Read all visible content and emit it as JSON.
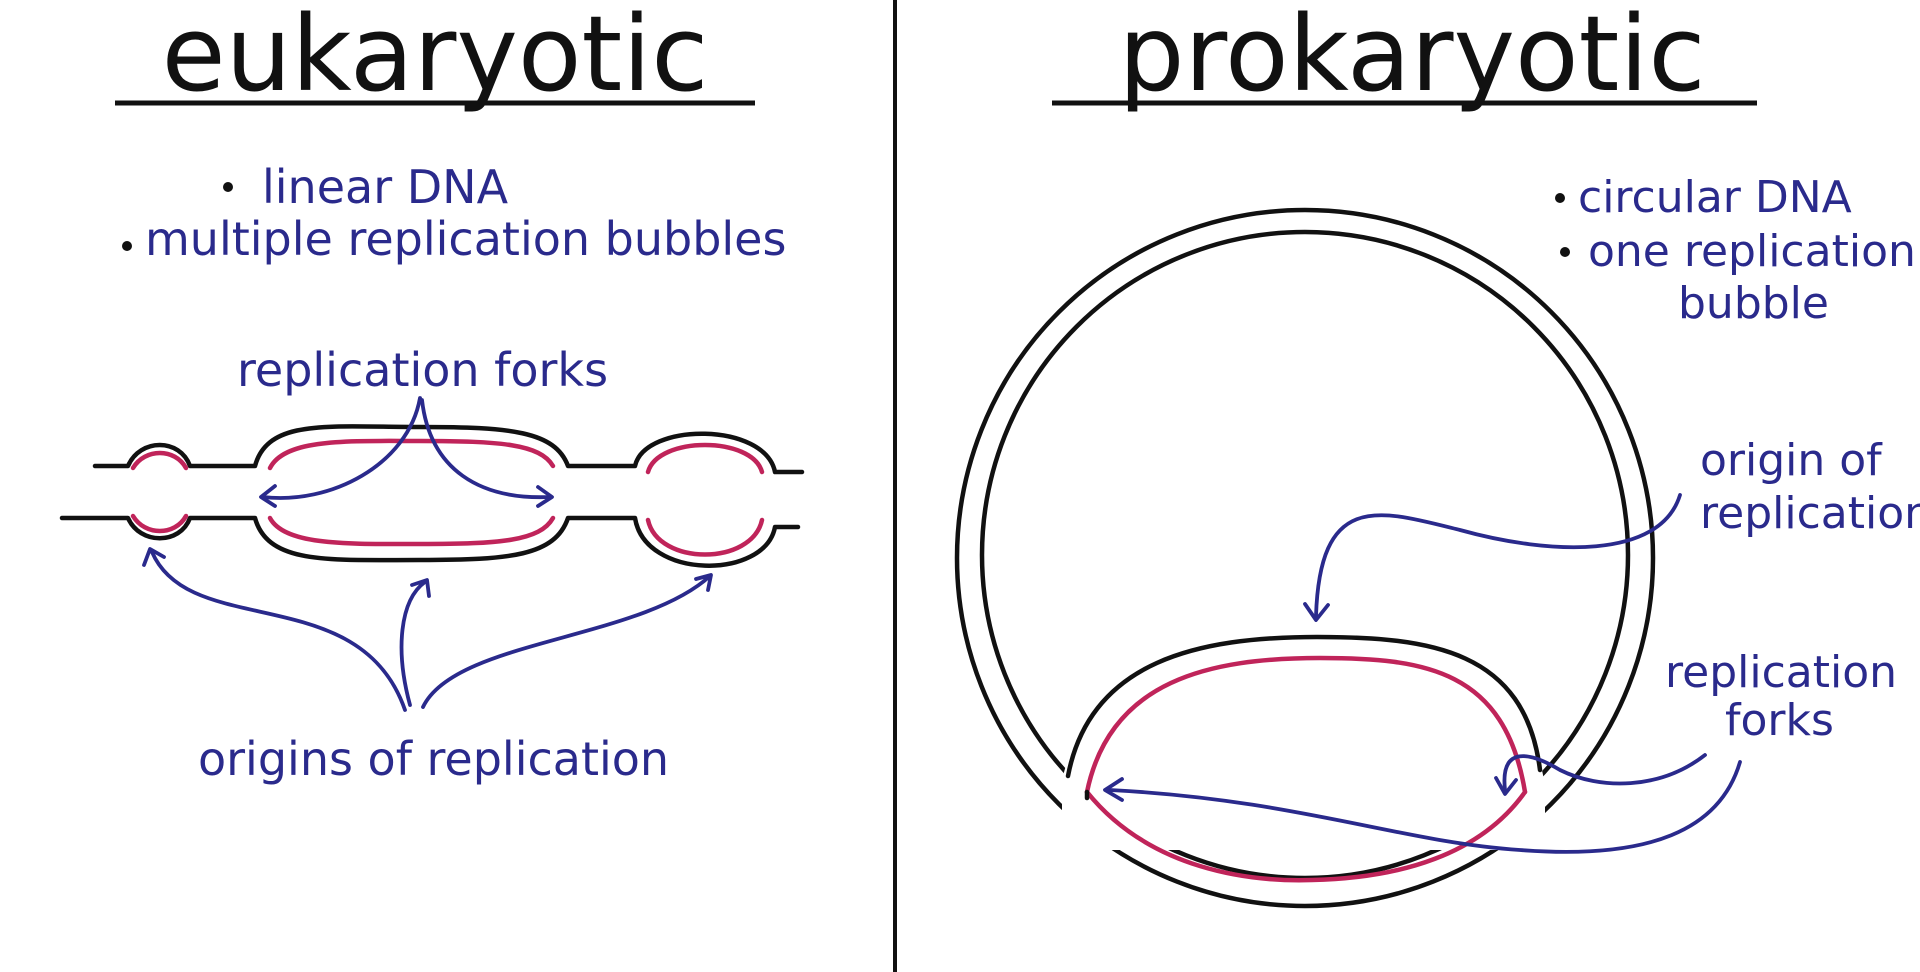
{
  "eukaryotic": {
    "title": "eukaryotic",
    "bullets": [
      "linear DNA",
      "multiple replication bubbles"
    ],
    "label_forks": "replication forks",
    "label_origins": "origins of replication"
  },
  "prokaryotic": {
    "title": "prokaryotic",
    "bullets": [
      "circular DNA",
      "one replication",
      "bubble"
    ],
    "label_origin": [
      "origin of",
      "replication"
    ],
    "label_forks": [
      "replication",
      "forks"
    ]
  },
  "colors": {
    "dna_strand": "#111111",
    "new_strand": "#c0245a",
    "annotation": "#2a2a8c",
    "background": "#ffffff"
  }
}
